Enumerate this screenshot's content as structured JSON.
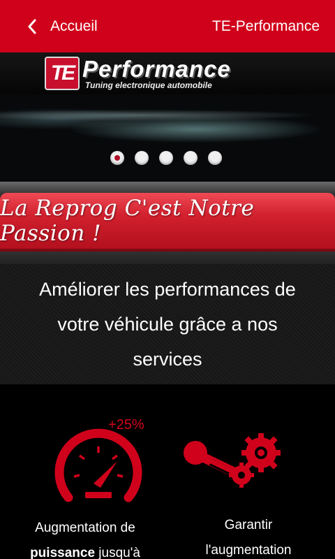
{
  "appbar": {
    "back_label": "Accueil",
    "title": "TE-Performance",
    "color": "#d0021b"
  },
  "slider": {
    "logo_badge": "TE",
    "logo_title": "Performance",
    "logo_subtitle": "Tuning electronique automobile",
    "slide_count": 5,
    "active_slide": 1
  },
  "banner": {
    "slogan": "La Reprog C'est Notre Passion !"
  },
  "intro": {
    "text": "Améliorer les performances de votre véhicule grâce a nos services"
  },
  "services": [
    {
      "icon": "speedometer-icon",
      "badge": "+25%",
      "line1": "Augmentation de",
      "line2_bold": "puissance",
      "line2_rest": " jusqu'à"
    },
    {
      "icon": "piston-gear-icon",
      "line1": "Garantir",
      "line2": "l'augmentation"
    }
  ],
  "colors": {
    "accent": "#d0021b",
    "background": "#000000"
  }
}
